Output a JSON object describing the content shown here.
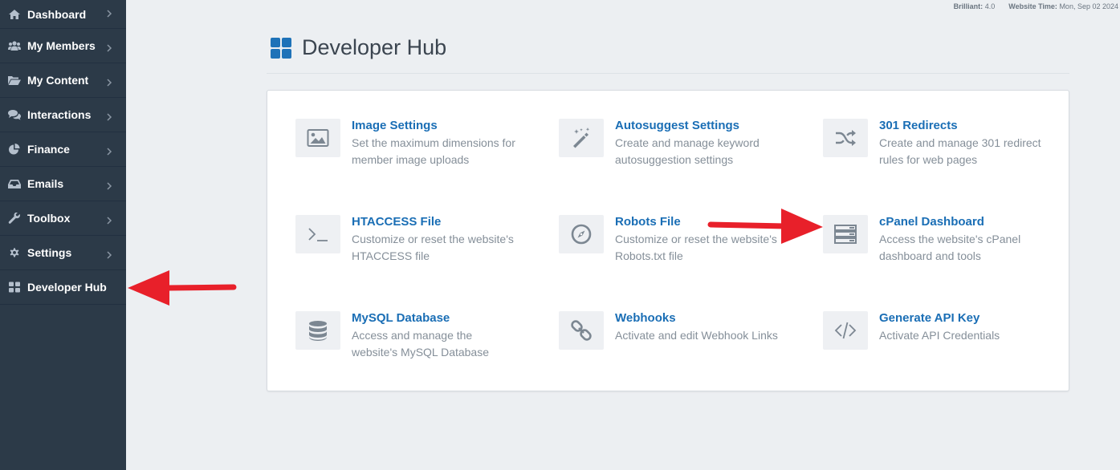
{
  "sidebar": {
    "items": [
      {
        "label": "Dashboard",
        "icon": "home-icon",
        "chevron": true
      },
      {
        "label": "My Members",
        "icon": "users-icon",
        "chevron": true
      },
      {
        "label": "My Content",
        "icon": "folder-open-icon",
        "chevron": true
      },
      {
        "label": "Interactions",
        "icon": "comments-icon",
        "chevron": true
      },
      {
        "label": "Finance",
        "icon": "pie-chart-icon",
        "chevron": true
      },
      {
        "label": "Emails",
        "icon": "inbox-icon",
        "chevron": true
      },
      {
        "label": "Toolbox",
        "icon": "wrench-icon",
        "chevron": true
      },
      {
        "label": "Settings",
        "icon": "gear-icon",
        "chevron": true
      },
      {
        "label": "Developer Hub",
        "icon": "grid-icon",
        "chevron": false
      }
    ]
  },
  "topbar": {
    "version_label": "Brilliant:",
    "version_value": "4.0",
    "time_label": "Website Time:",
    "time_value": "Mon, Sep 02 2024"
  },
  "page": {
    "title": "Developer Hub",
    "title_icon": "grid-icon",
    "accent_color": "#1e72b8"
  },
  "tools": [
    {
      "title": "Image Settings",
      "desc": "Set the maximum dimensions for member image uploads",
      "icon": "image-icon"
    },
    {
      "title": "Autosuggest Settings",
      "desc": "Create and manage keyword autosuggestion settings",
      "icon": "magic-wand-icon"
    },
    {
      "title": "301 Redirects",
      "desc": "Create and manage 301 redirect rules for web pages",
      "icon": "shuffle-icon"
    },
    {
      "title": "HTACCESS File",
      "desc": "Customize or reset the website's HTACCESS file",
      "icon": "terminal-icon"
    },
    {
      "title": "Robots File",
      "desc": "Customize or reset the website's Robots.txt file",
      "icon": "compass-icon"
    },
    {
      "title": "cPanel Dashboard",
      "desc": "Access the website's cPanel dashboard and tools",
      "icon": "server-icon"
    },
    {
      "title": "MySQL Database",
      "desc": "Access and manage the website's MySQL Database",
      "icon": "database-icon"
    },
    {
      "title": "Webhooks",
      "desc": "Activate and edit Webhook Links",
      "icon": "link-icon"
    },
    {
      "title": "Generate API Key",
      "desc": "Activate API Credentials",
      "icon": "code-icon"
    }
  ],
  "annotations": {
    "arrow_color": "#e8202a"
  }
}
